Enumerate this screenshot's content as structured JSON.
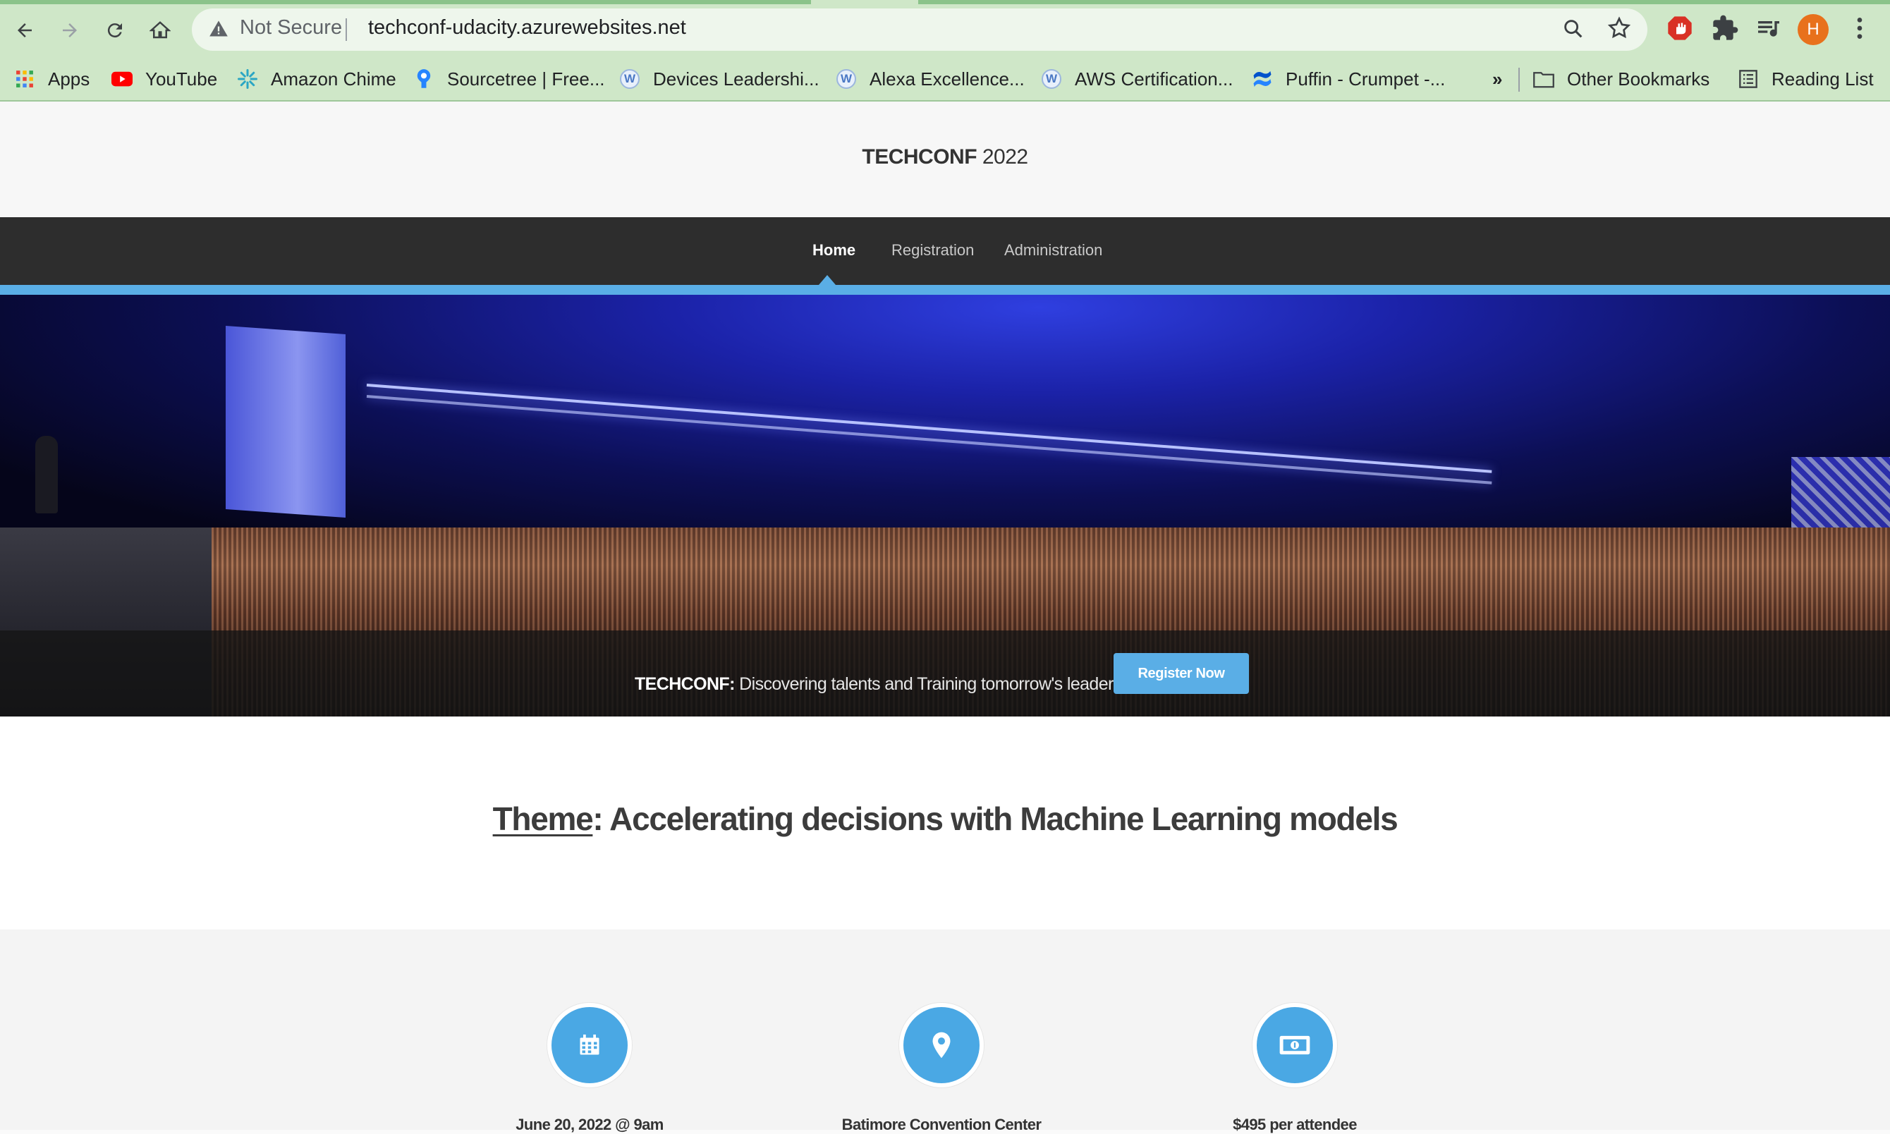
{
  "browser": {
    "not_secure": "Not Secure",
    "url": "techconf-udacity.azurewebsites.net",
    "avatar_initial": "H",
    "bookmarks": [
      {
        "label": "Apps",
        "icon": "apps-grid-icon"
      },
      {
        "label": "YouTube",
        "icon": "youtube-icon"
      },
      {
        "label": "Amazon Chime",
        "icon": "amazon-chime-icon"
      },
      {
        "label": "Sourcetree | Free...",
        "icon": "sourcetree-icon"
      },
      {
        "label": "Devices Leadershi...",
        "icon": "w-icon"
      },
      {
        "label": "Alexa Excellence...",
        "icon": "w-icon"
      },
      {
        "label": "AWS Certification...",
        "icon": "w-icon"
      },
      {
        "label": "Puffin - Crumpet -...",
        "icon": "confluence-icon"
      }
    ],
    "overflow": "»",
    "other_bookmarks": "Other Bookmarks",
    "reading_list": "Reading List"
  },
  "site": {
    "title_bold": "TECHCONF",
    "title_year": " 2022",
    "nav": [
      "Home",
      "Registration",
      "Administration"
    ],
    "hero": {
      "tagline_brand": "TECHCONF:",
      "tagline_text": " Discovering talents and Training tomorrow's leaders",
      "cta": "Register Now"
    },
    "theme_label": "Theme",
    "theme_text": ": Accelerating decisions with Machine Learning models",
    "info": [
      {
        "icon": "calendar-icon",
        "label": "June 20, 2022 @ 9am"
      },
      {
        "icon": "location-pin-icon",
        "label": "Batimore Convention Center"
      },
      {
        "icon": "money-icon",
        "label": "$495 per attendee"
      }
    ]
  },
  "colors": {
    "accent": "#5aaee6",
    "navbar": "#2d2d2d",
    "chrome": "#cfe7c8"
  }
}
